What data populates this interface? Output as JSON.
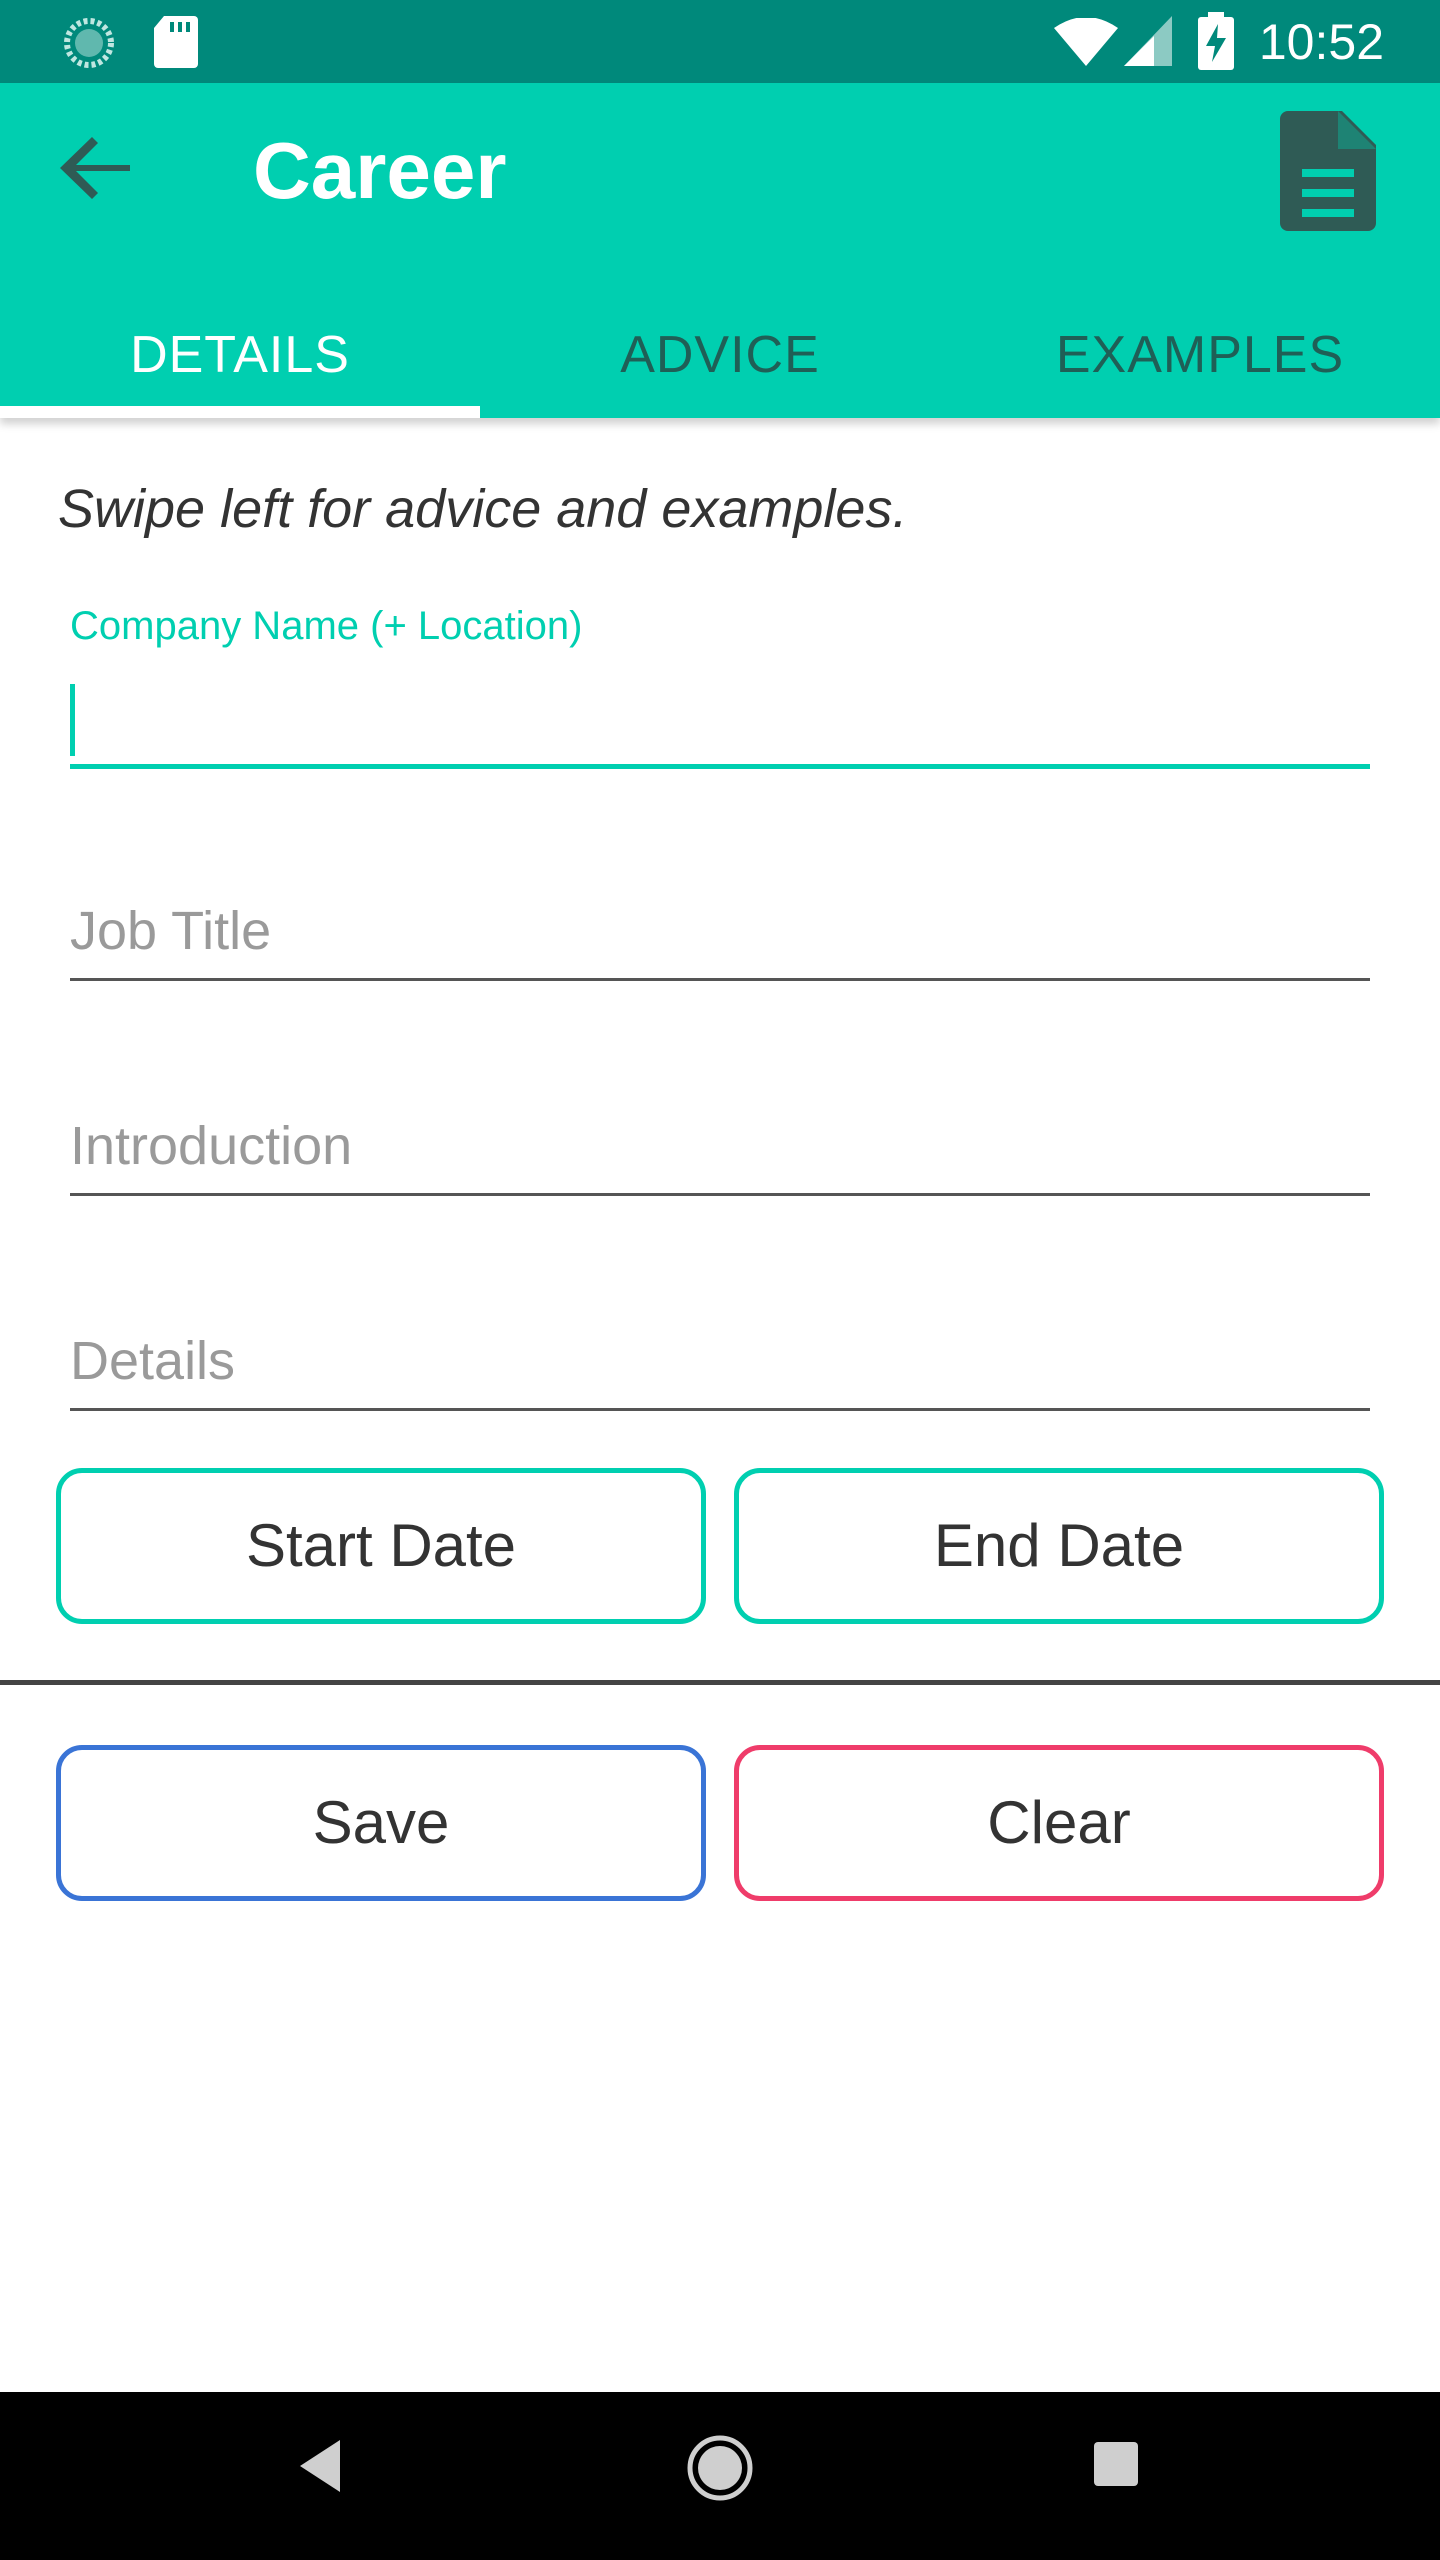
{
  "status_bar": {
    "time": "10:52",
    "left_icons": [
      "sync-status-icon",
      "sd-card-icon"
    ],
    "right_icons": [
      "wifi-icon",
      "signal-icon",
      "battery-charging-icon"
    ]
  },
  "app_bar": {
    "title": "Career",
    "back_icon": "arrow-back-icon",
    "action_icon": "document-icon",
    "background_color": "#00cfb0"
  },
  "tabs": [
    {
      "label": "DETAILS",
      "active": true
    },
    {
      "label": "ADVICE",
      "active": false
    },
    {
      "label": "EXAMPLES",
      "active": false
    }
  ],
  "hint_text": "Swipe left for advice and examples.",
  "form": {
    "company": {
      "label": "Company Name (+ Location)",
      "value": ""
    },
    "job_title": {
      "placeholder": "Job Title"
    },
    "introduction": {
      "placeholder": "Introduction"
    },
    "details": {
      "placeholder": "Details"
    }
  },
  "date_buttons": {
    "start": "Start Date",
    "end": "End Date"
  },
  "action_buttons": {
    "save": "Save",
    "clear": "Clear",
    "save_color": "#3a74d6",
    "clear_color": "#ef3c6a"
  },
  "nav_bar": {
    "icons": [
      "back-triangle-icon",
      "home-circle-icon",
      "recents-square-icon"
    ]
  }
}
